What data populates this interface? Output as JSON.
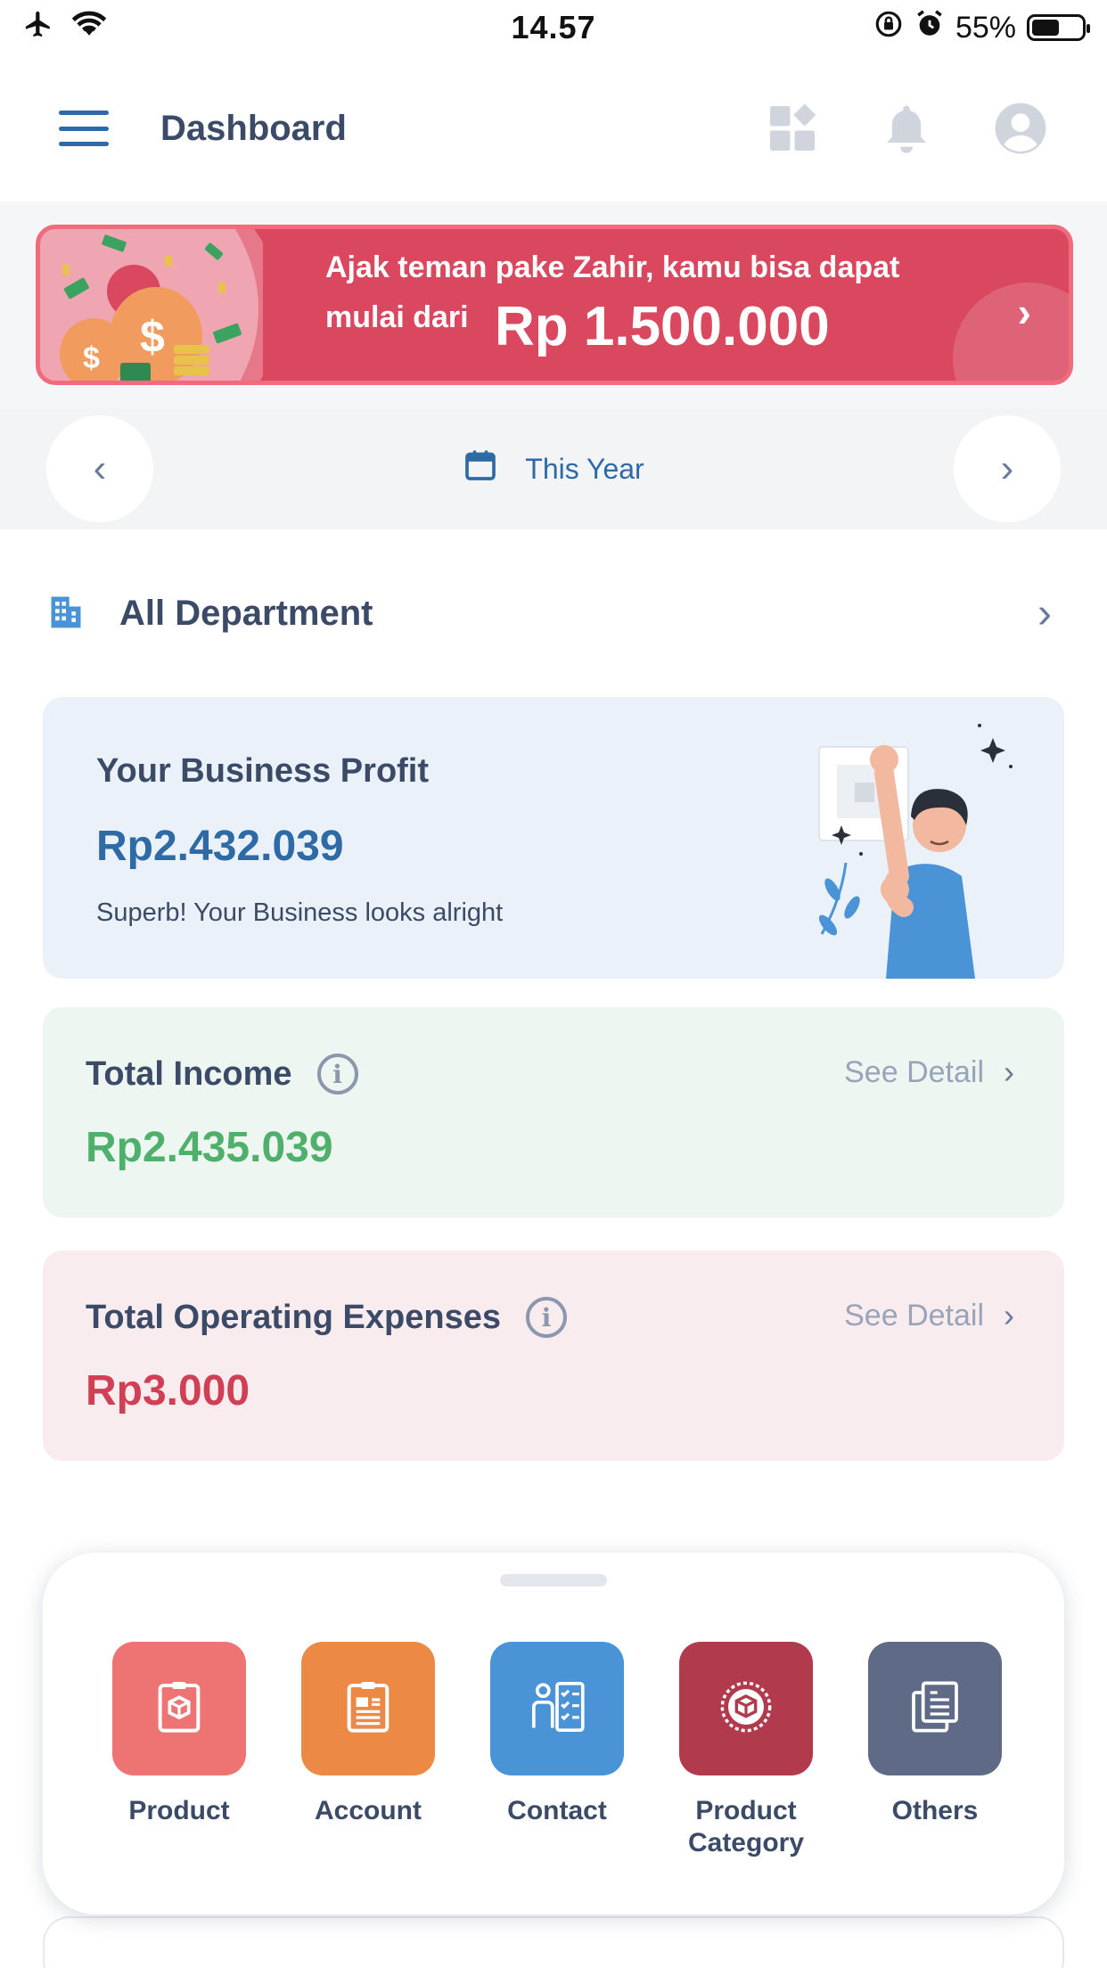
{
  "status_bar": {
    "time": "14.57",
    "battery_percent": "55%",
    "battery_level": 0.55,
    "icons": [
      "airplane-icon",
      "wifi-icon",
      "orientation-lock-icon",
      "alarm-icon",
      "battery-icon"
    ]
  },
  "header": {
    "title": "Dashboard",
    "icons": [
      "menu-icon",
      "widgets-icon",
      "bell-icon",
      "profile-icon"
    ]
  },
  "promo": {
    "line1": "Ajak teman pake Zahir, kamu bisa dapat",
    "line2": "mulai dari",
    "amount": "Rp 1.500.000",
    "arrow": "›"
  },
  "period": {
    "label": "This Year",
    "prev": "‹",
    "next": "›"
  },
  "department": {
    "label": "All Department",
    "chevron": "›"
  },
  "profit_card": {
    "title": "Your Business Profit",
    "value": "Rp2.432.039",
    "subtitle": "Superb! Your Business looks alright"
  },
  "income_card": {
    "title": "Total Income",
    "info": "i",
    "see_detail": "See Detail",
    "chevron": "›",
    "value": "Rp2.435.039"
  },
  "expense_card": {
    "title": "Total Operating Expenses",
    "info": "i",
    "see_detail": "See Detail",
    "chevron": "›",
    "value": "Rp3.000"
  },
  "quick_menu": {
    "items": [
      {
        "label": "Product",
        "color": "#ee7373",
        "icon": "product-box-icon"
      },
      {
        "label": "Account",
        "color": "#ec8a45",
        "icon": "account-clipboard-icon"
      },
      {
        "label": "Contact",
        "color": "#4a93d6",
        "icon": "contact-list-icon"
      },
      {
        "label": "Product\nCategory",
        "color": "#b13a4d",
        "icon": "product-category-icon"
      },
      {
        "label": "Others",
        "color": "#5f6a87",
        "icon": "others-documents-icon"
      }
    ]
  },
  "colors": {
    "primary": "#2e6aa6",
    "income": "#4fb06b",
    "expense": "#d13f55",
    "banner": "#d9485e"
  }
}
